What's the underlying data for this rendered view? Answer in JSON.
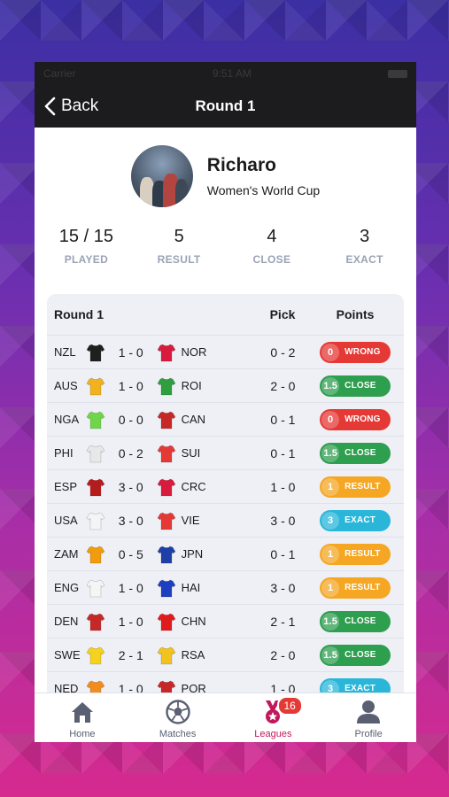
{
  "status_bar": {
    "carrier": "Carrier",
    "time": "9:51 AM"
  },
  "nav": {
    "back_label": "Back",
    "title": "Round 1"
  },
  "profile": {
    "name": "Richaro",
    "league": "Women's World Cup"
  },
  "stats": [
    {
      "value": "15 / 15",
      "label": "PLAYED"
    },
    {
      "value": "5",
      "label": "RESULT"
    },
    {
      "value": "4",
      "label": "CLOSE"
    },
    {
      "value": "3",
      "label": "EXACT"
    }
  ],
  "table": {
    "headers": {
      "round": "Round 1",
      "pick": "Pick",
      "points": "Points"
    },
    "rows": [
      {
        "home": "NZL",
        "home_shirt": "#1f1f1f",
        "score": "1 - 0",
        "away": "NOR",
        "away_shirt": "#d81b3c",
        "pick": "0 - 2",
        "pts": "0",
        "label": "WRONG",
        "color": "#e53935"
      },
      {
        "home": "AUS",
        "home_shirt": "#f2b21e",
        "score": "1 - 0",
        "away": "ROI",
        "away_shirt": "#2e9e3f",
        "pick": "2 - 0",
        "pts": "1.5",
        "label": "CLOSE",
        "color": "#2e9e4f"
      },
      {
        "home": "NGA",
        "home_shirt": "#6fd64a",
        "score": "0 - 0",
        "away": "CAN",
        "away_shirt": "#c62828",
        "pick": "0 - 1",
        "pts": "0",
        "label": "WRONG",
        "color": "#e53935"
      },
      {
        "home": "PHI",
        "home_shirt": "#e8e8e8",
        "score": "0 - 2",
        "away": "SUI",
        "away_shirt": "#e53935",
        "pick": "0 - 1",
        "pts": "1.5",
        "label": "CLOSE",
        "color": "#2e9e4f"
      },
      {
        "home": "ESP",
        "home_shirt": "#b71c1c",
        "score": "3 - 0",
        "away": "CRC",
        "away_shirt": "#d81b3c",
        "pick": "1 - 0",
        "pts": "1",
        "label": "RESULT",
        "color": "#f5a623"
      },
      {
        "home": "USA",
        "home_shirt": "#f5f5f5",
        "score": "3 - 0",
        "away": "VIE",
        "away_shirt": "#e53935",
        "pick": "3 - 0",
        "pts": "3",
        "label": "EXACT",
        "color": "#29b6d8"
      },
      {
        "home": "ZAM",
        "home_shirt": "#f29b0c",
        "score": "0 - 5",
        "away": "JPN",
        "away_shirt": "#1e3fa8",
        "pick": "0 - 1",
        "pts": "1",
        "label": "RESULT",
        "color": "#f5a623"
      },
      {
        "home": "ENG",
        "home_shirt": "#f5f5f5",
        "score": "1 - 0",
        "away": "HAI",
        "away_shirt": "#1e3fc0",
        "pick": "3 - 0",
        "pts": "1",
        "label": "RESULT",
        "color": "#f5a623"
      },
      {
        "home": "DEN",
        "home_shirt": "#c62828",
        "score": "1 - 0",
        "away": "CHN",
        "away_shirt": "#e01b1b",
        "pick": "2 - 1",
        "pts": "1.5",
        "label": "CLOSE",
        "color": "#2e9e4f"
      },
      {
        "home": "SWE",
        "home_shirt": "#f5d21e",
        "score": "2 - 1",
        "away": "RSA",
        "away_shirt": "#f2c21e",
        "pick": "2 - 0",
        "pts": "1.5",
        "label": "CLOSE",
        "color": "#2e9e4f"
      },
      {
        "home": "NED",
        "home_shirt": "#f28c1e",
        "score": "1 - 0",
        "away": "POR",
        "away_shirt": "#c62828",
        "pick": "1 - 0",
        "pts": "3",
        "label": "EXACT",
        "color": "#29b6d8"
      }
    ]
  },
  "tabs": [
    {
      "label": "Home",
      "icon": "home-icon"
    },
    {
      "label": "Matches",
      "icon": "soccer-ball-icon"
    },
    {
      "label": "Leagues",
      "icon": "medal-icon",
      "badge": "16"
    },
    {
      "label": "Profile",
      "icon": "user-icon"
    }
  ],
  "colors": {
    "accent": "#c2185b",
    "nav_bg": "#1c1c1e"
  }
}
